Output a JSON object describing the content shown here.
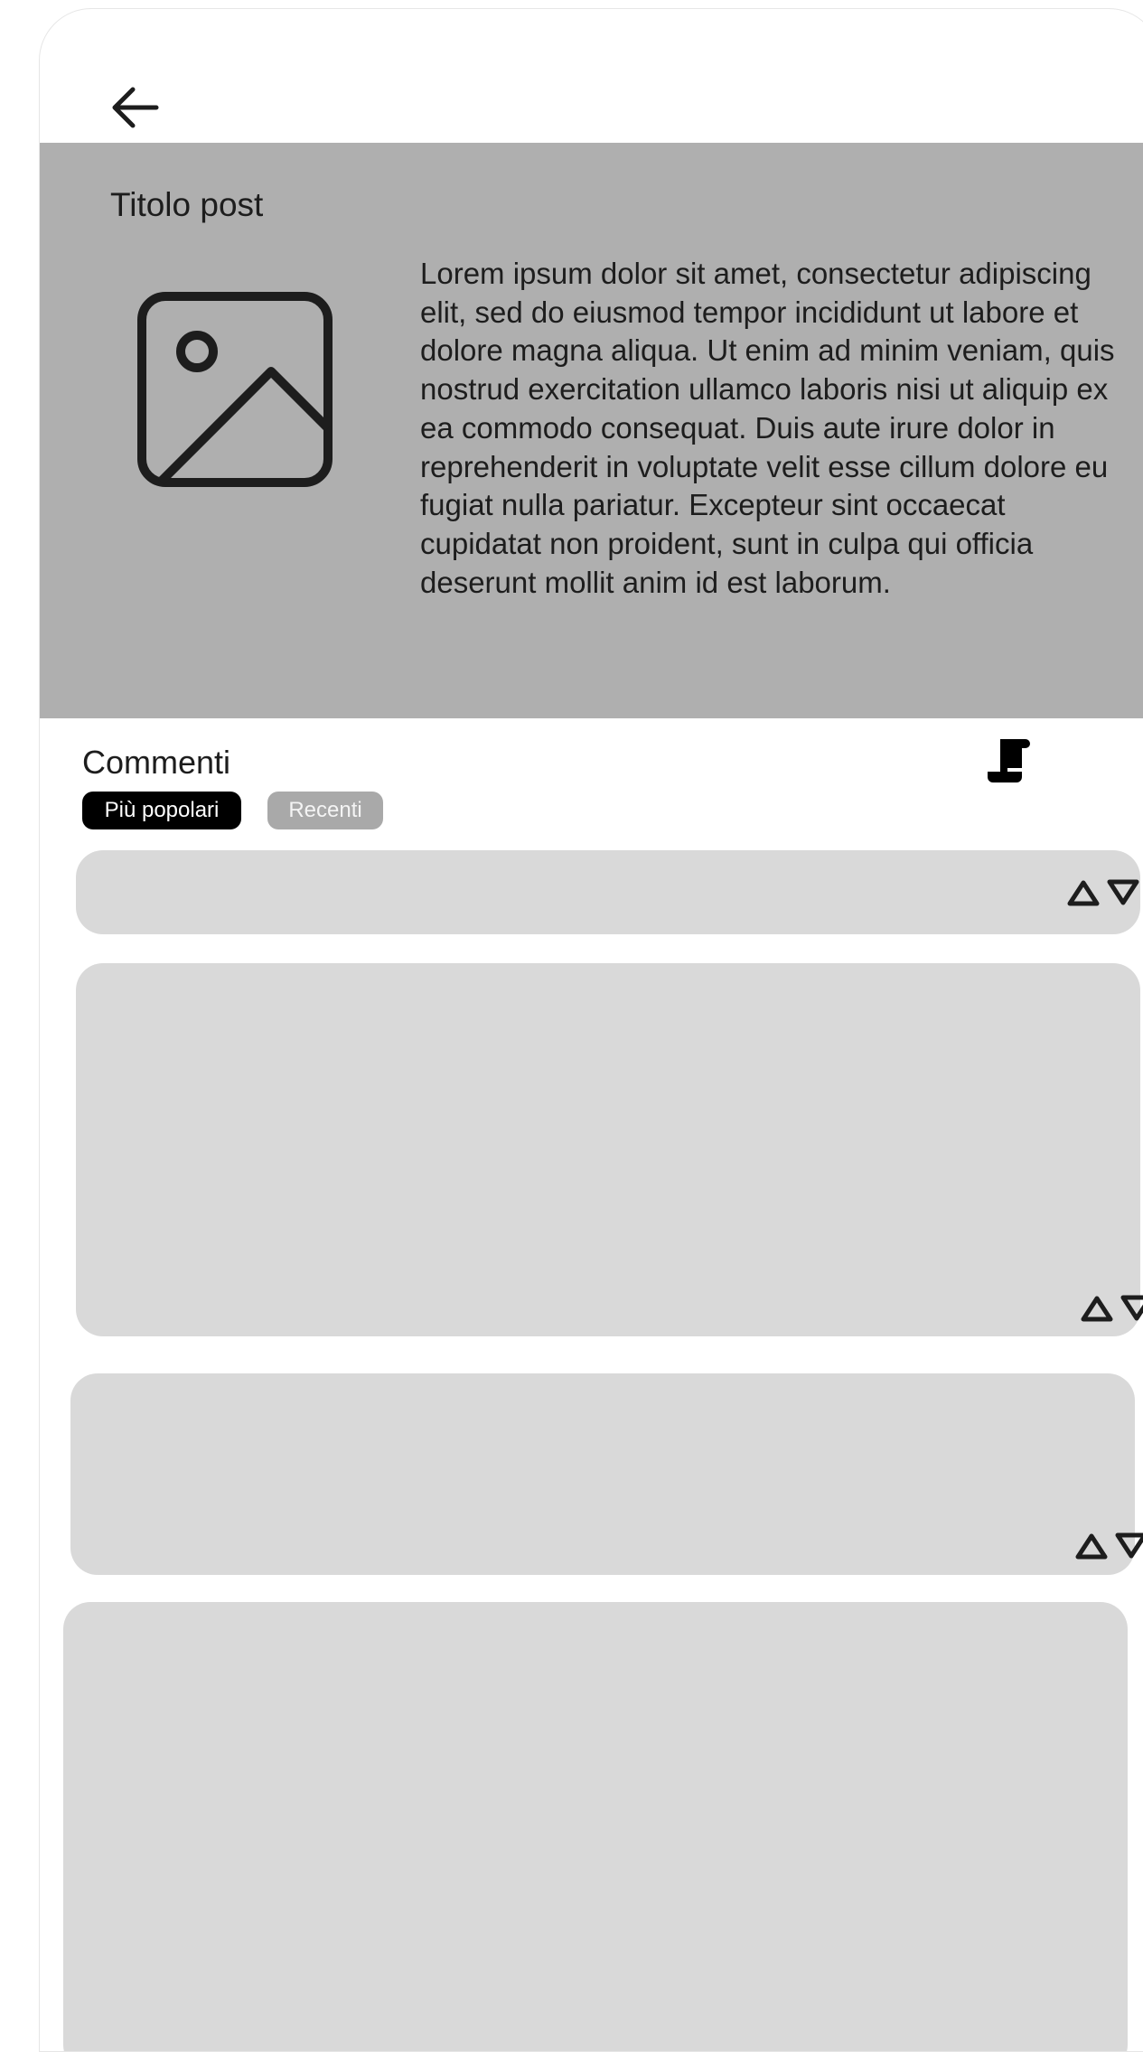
{
  "icons": {
    "back": "arrow-left-icon",
    "image": "image-placeholder-icon",
    "comments": "scroll-icon",
    "upvote": "triangle-up-icon",
    "downvote": "triangle-down-icon"
  },
  "colors": {
    "post_background": "#afafaf",
    "comment_background": "#d9d9d9",
    "active_pill": "#000000",
    "inactive_pill": "#a9a9a9"
  },
  "post": {
    "title": "Titolo post",
    "body": "Lorem ipsum dolor sit amet, consectetur adipiscing elit, sed do eiusmod tempor incididunt ut labore et dolore magna aliqua. Ut enim ad minim veniam, quis nostrud exercitation ullamco laboris nisi ut aliquip ex ea commodo consequat. Duis aute irure dolor in reprehenderit in voluptate velit esse cillum dolore eu fugiat nulla pariatur. Excepteur sint occaecat cupidatat non proident, sunt in culpa qui officia deserunt mollit anim id est laborum."
  },
  "comments": {
    "title": "Commenti",
    "filters": [
      "Più popolari",
      "Recenti"
    ],
    "active_filter": "Più popolari"
  }
}
